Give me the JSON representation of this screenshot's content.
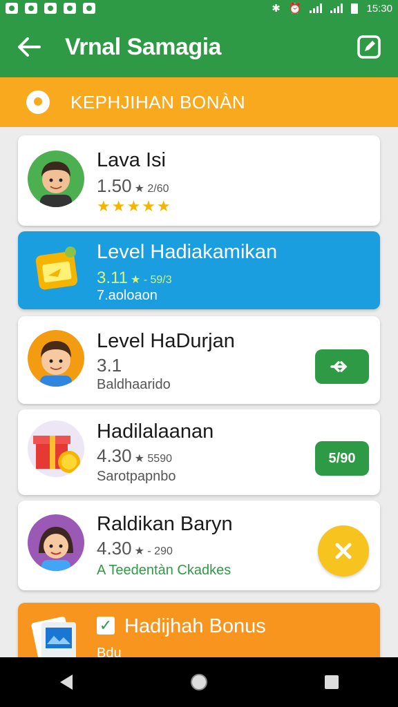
{
  "status_bar": {
    "time": "15:30"
  },
  "app_bar": {
    "title": "Vrnal Samagia"
  },
  "banner": {
    "text": "KEPHJIHAN BONÀN"
  },
  "cards": [
    {
      "title": "Lava Isi",
      "rating": "1.50",
      "rating_note": "★ 2/60",
      "stars": "★★★★★"
    },
    {
      "title": "Level Hadiakamikan",
      "rating": "3.11",
      "rating_note": "★ - 59/3",
      "subtitle": "7.aoloaon"
    },
    {
      "title": "Level HaDurjan",
      "rating": "3.1",
      "subtitle": "Baldhaarido",
      "action_icon": "shuffle-icon"
    },
    {
      "title": "Hadilalaanan",
      "rating": "4.30",
      "rating_note": "★ 5590",
      "subtitle": "Sarotpapnbo",
      "action_label": "5/90"
    },
    {
      "title": "Raldikan Baryn",
      "rating": "4.30",
      "rating_note": "★ - 290",
      "subtitle": "A Teedentàn Ckadkes",
      "action_icon": "close-icon"
    },
    {
      "title": "Hadijhah Bonus",
      "subtitle": "Bdu"
    }
  ],
  "colors": {
    "primary_green": "#2e9a45",
    "banner_orange": "#f8a91e",
    "highlight_blue": "#1a9ee0",
    "accent_orange": "#f7951f",
    "star_gold": "#f4b400"
  }
}
